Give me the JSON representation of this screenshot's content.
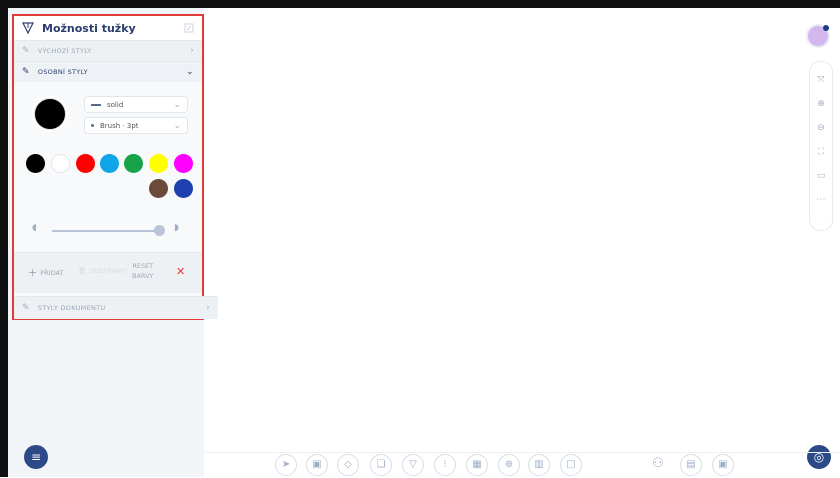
{
  "panel": {
    "title": "Možnosti tužky",
    "sections": {
      "default_styles": "VÝCHOZÍ STYLY",
      "personal_styles": "OSOBNÍ STYLY",
      "document_styles": "STYLY DOKUMENTU"
    },
    "line_style": "solid",
    "brush": "Brush · 3pt",
    "selected_color": "#000000",
    "palette": [
      "#000000",
      "#ffffff",
      "#ff0000",
      "#0ea5e9",
      "#16a34a",
      "#ffff00",
      "#ff00ff",
      "#6b4a3a",
      "#1e40af"
    ],
    "actions": {
      "add": "PŘIDAT",
      "remove": "ODSTRANIT",
      "reset_line1": "RESET",
      "reset_line2": "BARVY"
    }
  },
  "colors": {
    "accent": "#2c4a87",
    "highlight_border": "#e23a3a"
  },
  "icons": {
    "panel": "pen-nib-icon",
    "toolbar_right": [
      "expand-icon",
      "zoom-in-icon",
      "zoom-out-icon",
      "fit-icon",
      "present-icon",
      "more-icon"
    ],
    "bottom_tools": [
      "pointer-icon",
      "media-icon",
      "eraser-icon",
      "shapes-icon",
      "pen-icon",
      "text-icon",
      "table-icon",
      "web-icon",
      "chart-icon",
      "note-icon"
    ],
    "bottom_extra": [
      "users-icon",
      "library-icon",
      "dashboard-icon"
    ]
  }
}
